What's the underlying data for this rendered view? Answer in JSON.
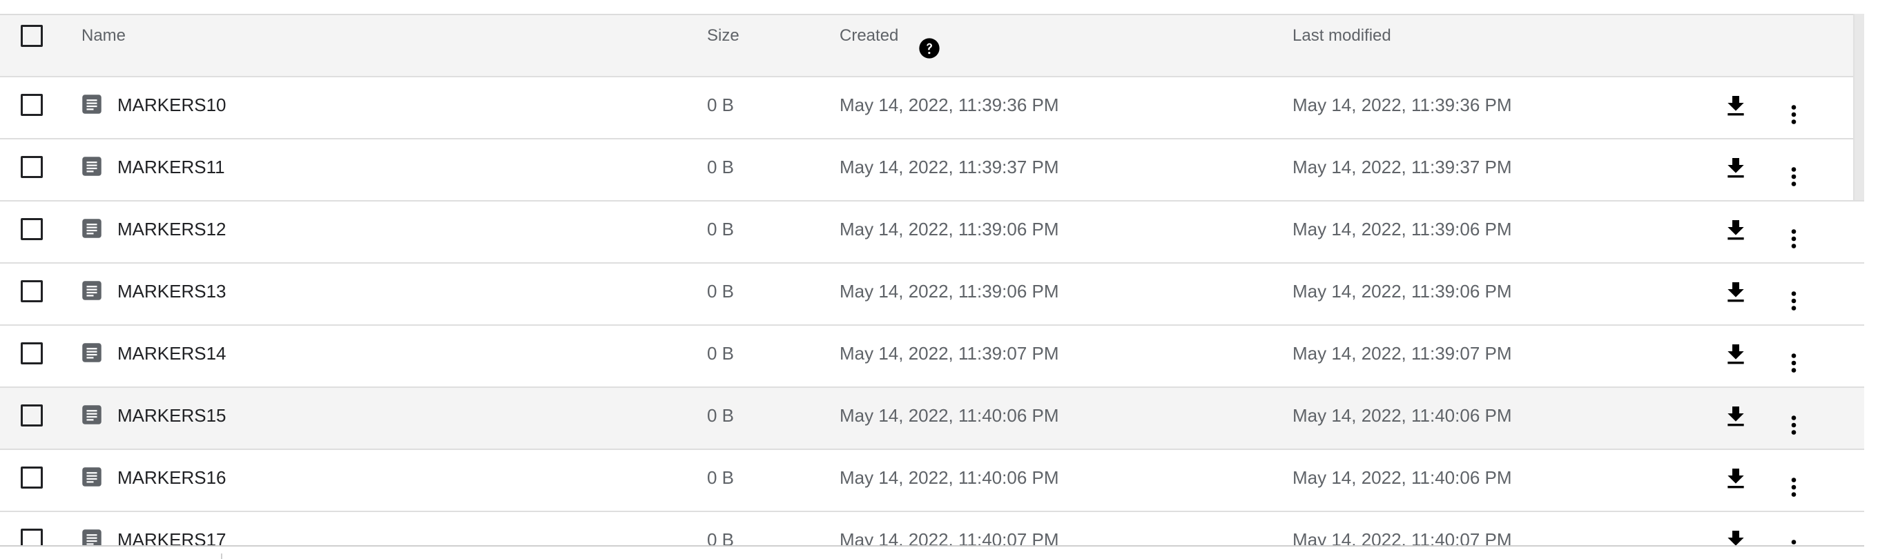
{
  "columns": {
    "name": "Name",
    "size": "Size",
    "created": "Created",
    "last_modified": "Last modified"
  },
  "icons": {
    "file": "description-icon",
    "help": "help-icon",
    "download": "download-icon",
    "more": "more-vert-icon"
  },
  "rows": [
    {
      "name": "MARKERS10",
      "size": "0 B",
      "created": "May 14, 2022, 11:39:36 PM",
      "modified": "May 14, 2022, 11:39:36 PM"
    },
    {
      "name": "MARKERS11",
      "size": "0 B",
      "created": "May 14, 2022, 11:39:37 PM",
      "modified": "May 14, 2022, 11:39:37 PM"
    },
    {
      "name": "MARKERS12",
      "size": "0 B",
      "created": "May 14, 2022, 11:39:06 PM",
      "modified": "May 14, 2022, 11:39:06 PM"
    },
    {
      "name": "MARKERS13",
      "size": "0 B",
      "created": "May 14, 2022, 11:39:06 PM",
      "modified": "May 14, 2022, 11:39:06 PM"
    },
    {
      "name": "MARKERS14",
      "size": "0 B",
      "created": "May 14, 2022, 11:39:07 PM",
      "modified": "May 14, 2022, 11:39:07 PM"
    },
    {
      "name": "MARKERS15",
      "size": "0 B",
      "created": "May 14, 2022, 11:40:06 PM",
      "modified": "May 14, 2022, 11:40:06 PM"
    },
    {
      "name": "MARKERS16",
      "size": "0 B",
      "created": "May 14, 2022, 11:40:06 PM",
      "modified": "May 14, 2022, 11:40:06 PM"
    },
    {
      "name": "MARKERS17",
      "size": "0 B",
      "created": "May 14, 2022, 11:40:07 PM",
      "modified": "May 14, 2022, 11:40:07 PM"
    }
  ]
}
